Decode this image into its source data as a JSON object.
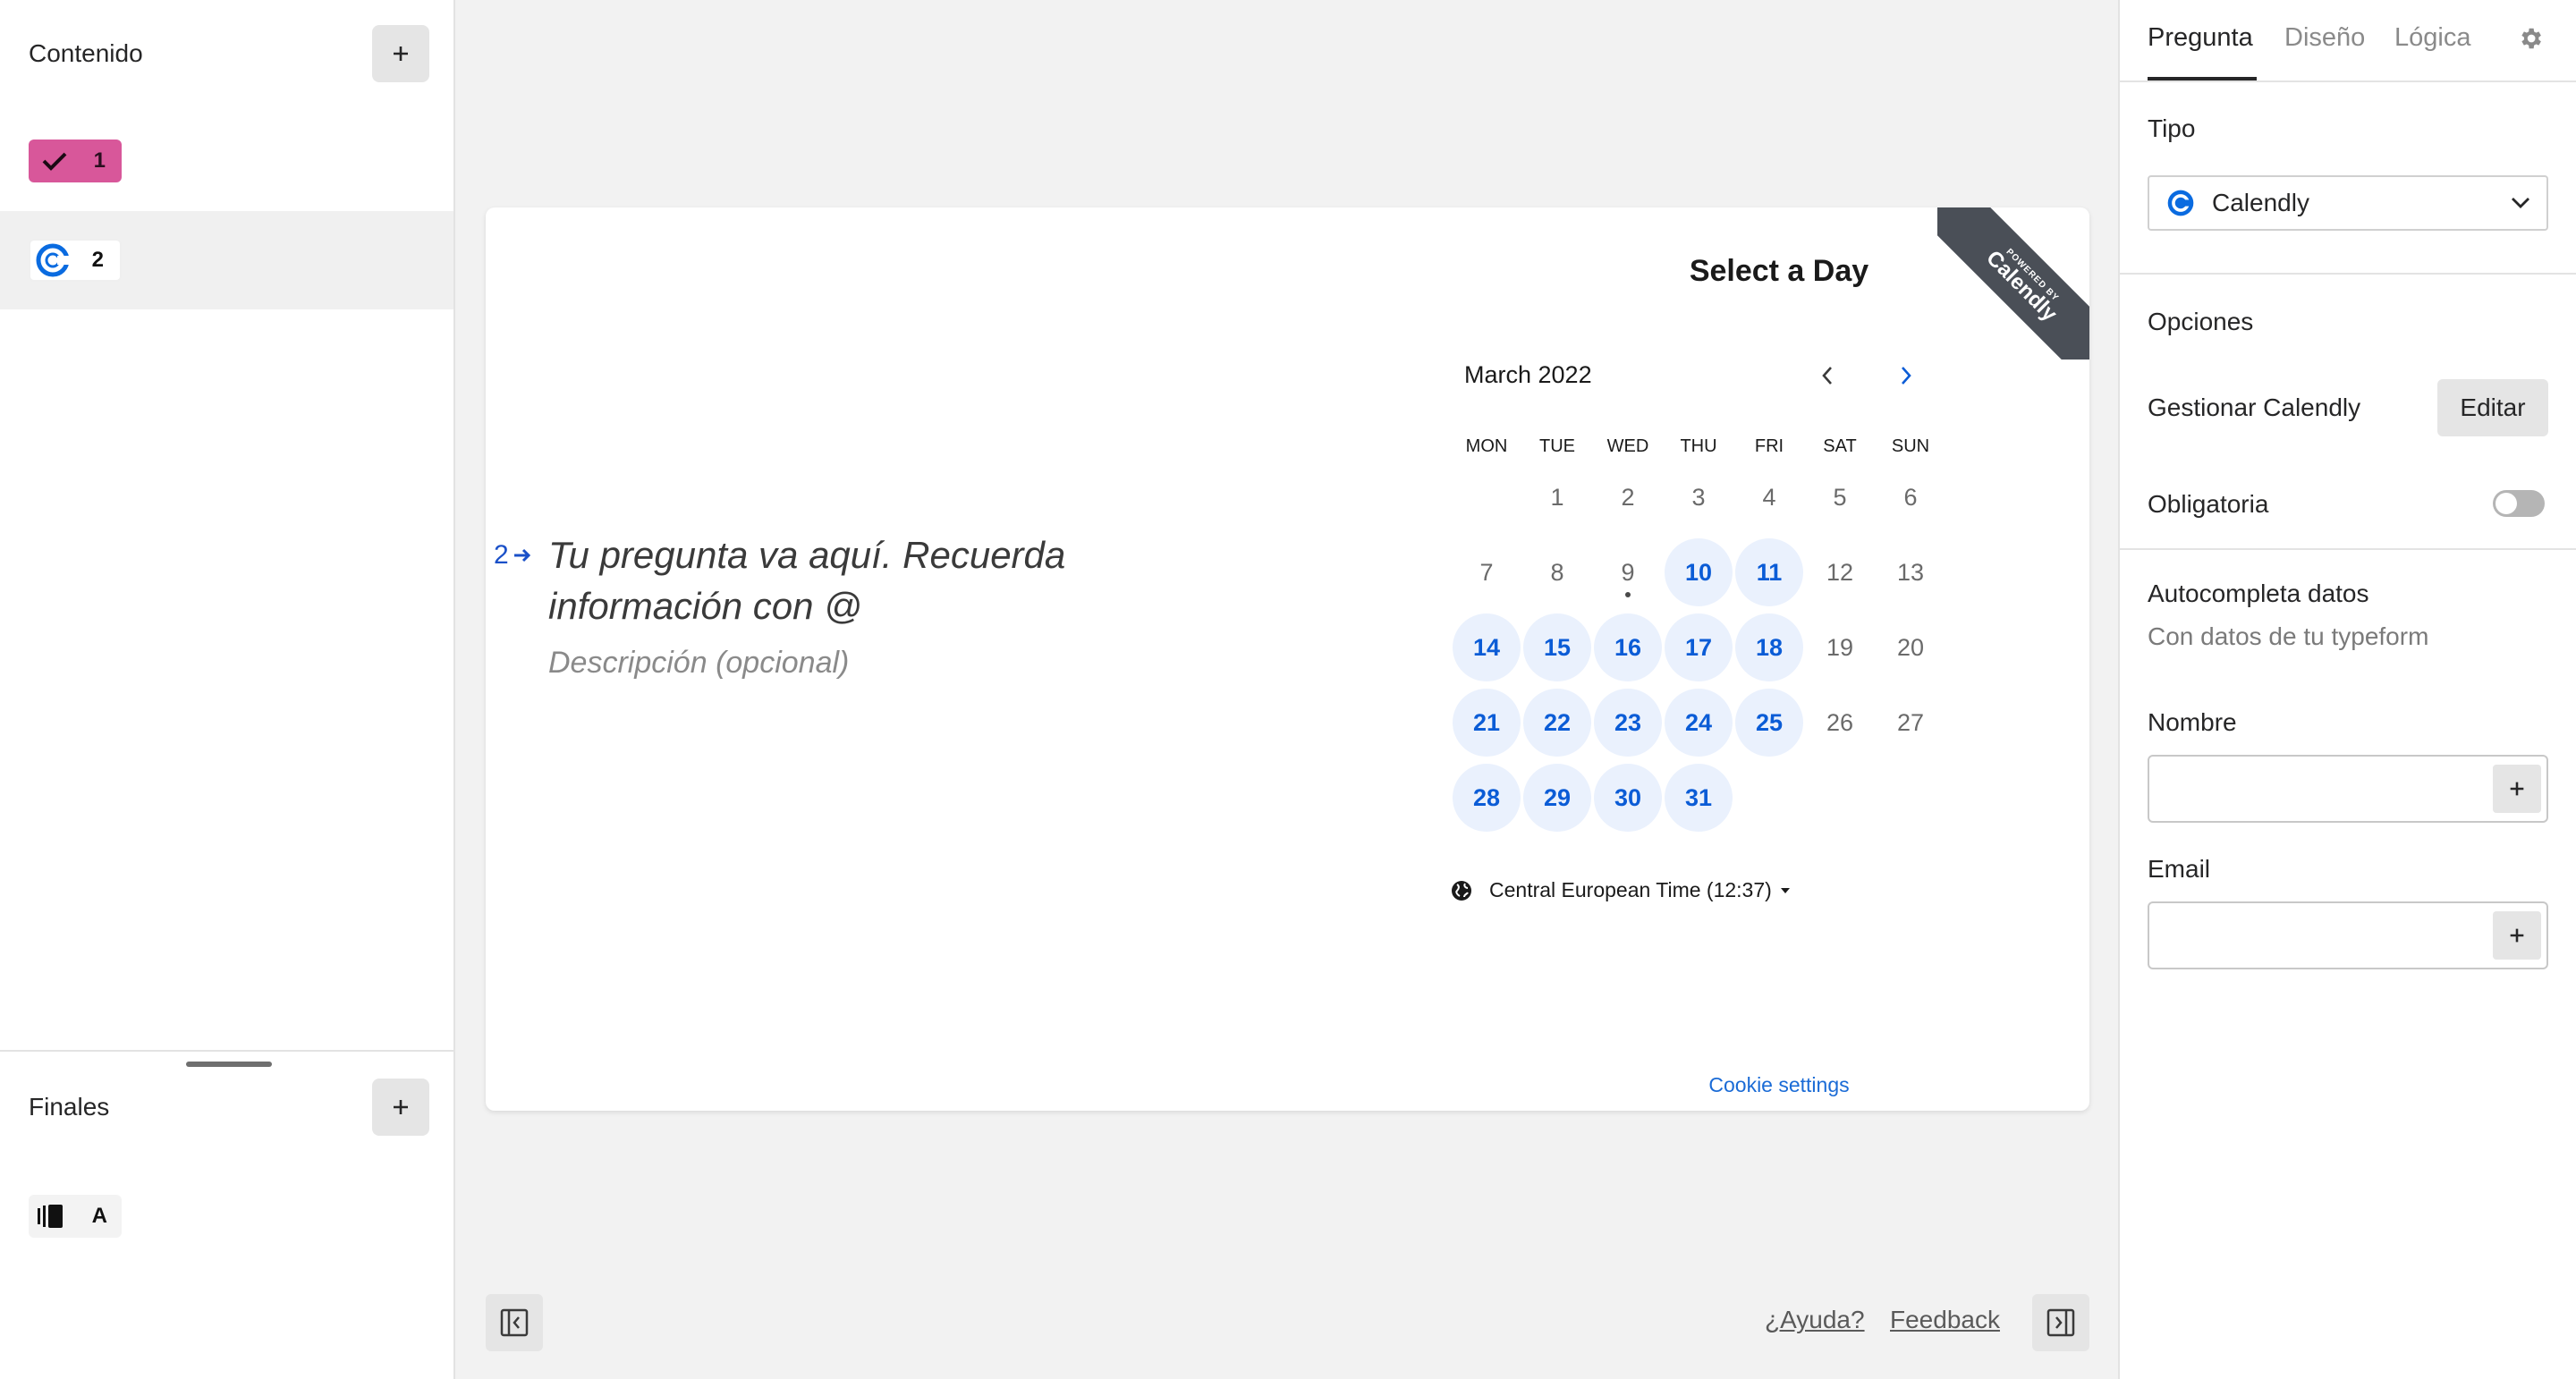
{
  "left_sidebar": {
    "content_title": "Contenido",
    "endings_title": "Finales",
    "questions": [
      {
        "number": "1",
        "type_icon": "checkmark-icon",
        "color": "#d8579a"
      },
      {
        "number": "2",
        "type_icon": "calendly-icon"
      }
    ],
    "endings": [
      {
        "label": "A",
        "type_icon": "ending-icon"
      }
    ]
  },
  "canvas": {
    "question_number": "2",
    "question_text": "Tu pregunta va aquí. Recuerda información con @",
    "description_placeholder": "Descripción (opcional)",
    "calendar": {
      "title": "Select a Day",
      "month": "March 2022",
      "weekdays": [
        "MON",
        "TUE",
        "WED",
        "THU",
        "FRI",
        "SAT",
        "SUN"
      ],
      "days": [
        [
          "",
          "1",
          "2",
          "3",
          "4",
          "5",
          "6"
        ],
        [
          "7",
          "8",
          "9",
          "10",
          "11",
          "12",
          "13"
        ],
        [
          "14",
          "15",
          "16",
          "17",
          "18",
          "19",
          "20"
        ],
        [
          "21",
          "22",
          "23",
          "24",
          "25",
          "26",
          "27"
        ],
        [
          "28",
          "29",
          "30",
          "31",
          "",
          "",
          ""
        ]
      ],
      "available_days": [
        "10",
        "11",
        "14",
        "15",
        "16",
        "17",
        "18",
        "21",
        "22",
        "23",
        "24",
        "25",
        "28",
        "29",
        "30",
        "31"
      ],
      "today": "9",
      "timezone": "Central European Time (12:37)",
      "cookie_link": "Cookie settings",
      "ribbon_small": "POWERED BY",
      "ribbon_big": "Calendly",
      "accent_color": "#0b5cd6"
    }
  },
  "footer": {
    "help_link": "¿Ayuda?",
    "feedback_link": "Feedback"
  },
  "right_panel": {
    "tabs": [
      {
        "label": "Pregunta",
        "active": true
      },
      {
        "label": "Diseño",
        "active": false
      },
      {
        "label": "Lógica",
        "active": false
      }
    ],
    "type_label": "Tipo",
    "type_value": "Calendly",
    "options_label": "Opciones",
    "manage_label": "Gestionar Calendly",
    "edit_button": "Editar",
    "required_label": "Obligatoria",
    "required_on": false,
    "autofill_title": "Autocompleta datos",
    "autofill_sub": "Con datos de tu typeform",
    "name_label": "Nombre",
    "email_label": "Email"
  }
}
